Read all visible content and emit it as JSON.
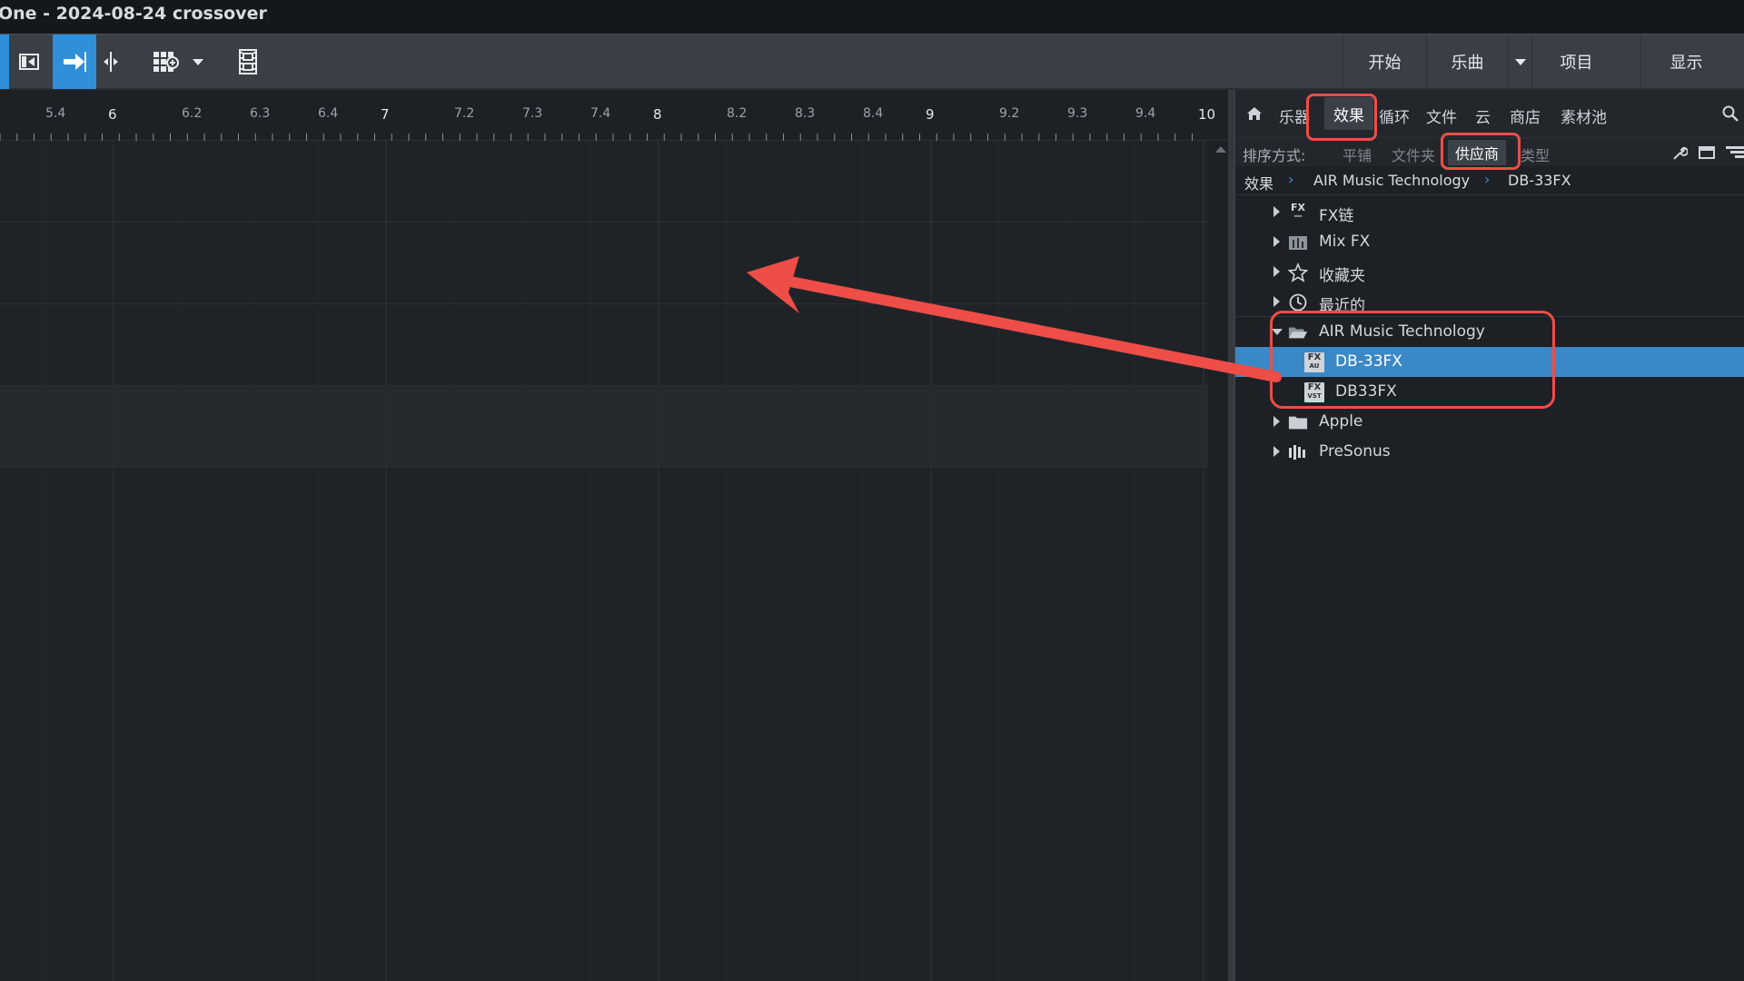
{
  "window": {
    "title": "One - 2024-08-24 crossover"
  },
  "toolbar": {
    "tools": [
      {
        "icon": "loop-icon"
      },
      {
        "icon": "snap-back-icon"
      },
      {
        "icon": "autoscroll-icon"
      },
      {
        "icon": "split-icon"
      },
      {
        "icon": "grid-snap-icon"
      },
      {
        "icon": "dropdown-arrow-icon"
      },
      {
        "icon": "film-strip-icon"
      }
    ],
    "nav": {
      "start": "开始",
      "song": "乐曲",
      "project": "项目",
      "show": "显示"
    }
  },
  "ruler": {
    "ticks": [
      "5.4",
      "6",
      "6.2",
      "6.3",
      "6.4",
      "7",
      "7.2",
      "7.3",
      "7.4",
      "8",
      "8.2",
      "8.3",
      "8.4",
      "9",
      "9.2",
      "9.3",
      "9.4",
      "10"
    ],
    "majors": [
      "6",
      "7",
      "8",
      "9",
      "10"
    ]
  },
  "browser": {
    "tabs": {
      "instruments": "乐器",
      "effects": "效果",
      "loops": "循环",
      "files": "文件",
      "cloud": "云",
      "shop": "商店",
      "pool": "素材池"
    },
    "sort": {
      "label": "排序方式:",
      "flat": "平铺",
      "folder": "文件夹",
      "vendor": "供应商",
      "type": "类型"
    },
    "breadcrumb": [
      "效果",
      "AIR Music Technology",
      "DB-33FX"
    ],
    "tree": [
      {
        "label": "FX链",
        "icon": "fx-chain-icon",
        "expanded": false,
        "level": 0
      },
      {
        "label": "Mix FX",
        "icon": "mix-fx-icon",
        "expanded": false,
        "level": 0
      },
      {
        "label": "收藏夹",
        "icon": "star-icon",
        "expanded": false,
        "level": 0
      },
      {
        "label": "最近的",
        "icon": "clock-icon",
        "expanded": false,
        "level": 0
      },
      {
        "label": "AIR Music Technology",
        "icon": "open-folder-icon",
        "expanded": true,
        "level": 0
      },
      {
        "label": "DB-33FX",
        "icon": "fx-plugin-icon",
        "badge": "AU",
        "level": 1,
        "selected": true
      },
      {
        "label": "DB33FX",
        "icon": "fx-plugin-icon",
        "badge": "VST",
        "level": 1,
        "selected": false
      },
      {
        "label": "Apple",
        "icon": "folder-icon",
        "expanded": false,
        "level": 0
      },
      {
        "label": "PreSonus",
        "icon": "presonus-icon",
        "expanded": false,
        "level": 0
      }
    ]
  },
  "colors": {
    "accent": "#2f8fd8",
    "selection": "#3b88c6",
    "annotation": "#ef4d47",
    "background": "#1f2328"
  }
}
